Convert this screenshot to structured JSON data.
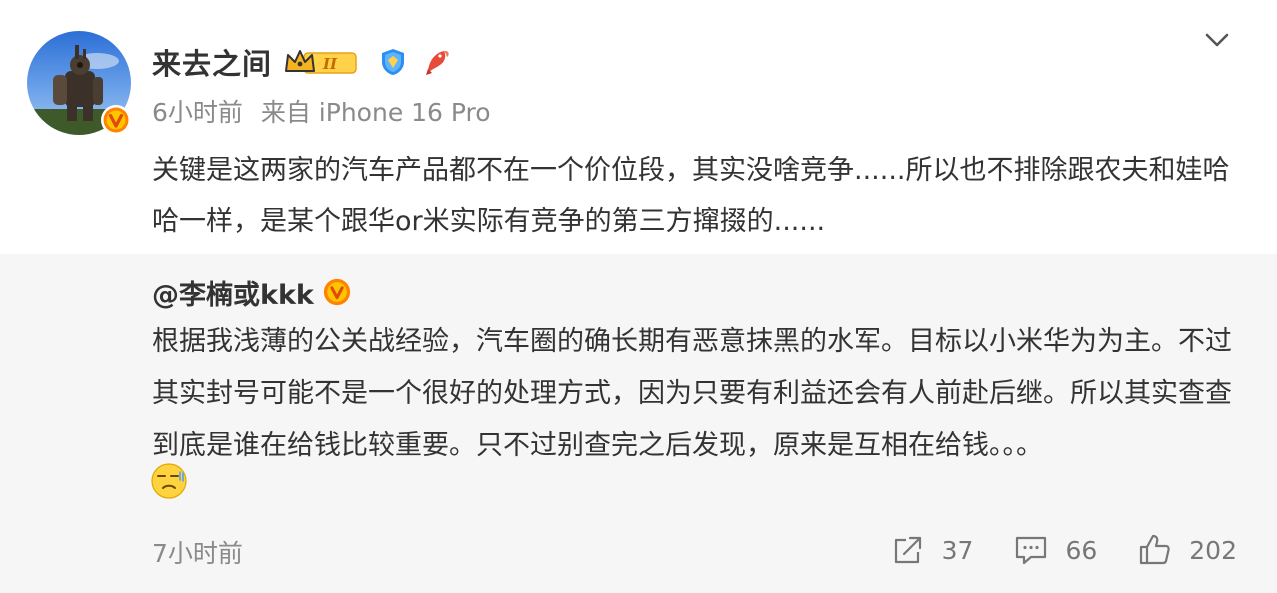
{
  "post": {
    "author": "来去之间",
    "time": "6小时前",
    "source": "来自 iPhone 16 Pro",
    "text": "关键是这两家的汽车产品都不在一个价位段，其实没啥竞争......所以也不排除跟农夫和娃哈哈一样，是某个跟华or米实际有竞争的第三方撺掇的......",
    "badges": [
      "crown-level-badge",
      "shield-badge",
      "koi-fish-badge"
    ],
    "level_label": "II"
  },
  "quote": {
    "author": "@李楠或kkk",
    "text": "根据我浅薄的公关战经验，汽车圈的确长期有恶意抹黑的水军。目标以小米华为为主。不过其实封号可能不是一个很好的处理方式，因为只要有利益还会有人前赴后继。所以其实查查到底是谁在给钱比较重要。只不过别查完之后发现，原来是互相在给钱。。。",
    "emoji": "awkward-face-emoji",
    "time": "7小时前",
    "actions": {
      "repost_count": "37",
      "comment_count": "66",
      "like_count": "202"
    }
  },
  "colors": {
    "accent_orange": "#f5a623",
    "verified_orange": "#ff8200",
    "text_primary": "#333333",
    "text_secondary": "#8a8a8a",
    "quote_bg": "#f6f6f6"
  }
}
